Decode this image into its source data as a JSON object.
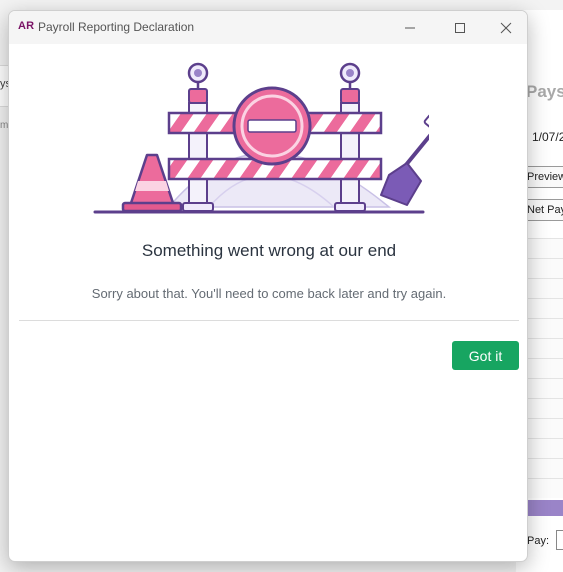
{
  "background_app": {
    "left_fragment_1": "ys",
    "left_fragment_2": "m",
    "right_title_fragment": "Pays",
    "right_date_fragment": "1/07/2",
    "right_button_1": "Preview",
    "right_button_2": "Net Pay",
    "bottom_label_fragment": "Pay:"
  },
  "dialog": {
    "app_badge": "AR",
    "title": "Payroll Reporting Declaration",
    "headline": "Something went wrong at our end",
    "message": "Sorry about that. You'll need to come back later and try again.",
    "primary_button": "Got it"
  },
  "window_controls": {
    "minimize": "minimize-icon",
    "maximize": "maximize-icon",
    "close": "close-icon"
  },
  "colors": {
    "brand": "#7a1466",
    "accent_green": "#17a561",
    "illustration_pink": "#ec6b9c",
    "illustration_purple": "#5c3f8c"
  }
}
